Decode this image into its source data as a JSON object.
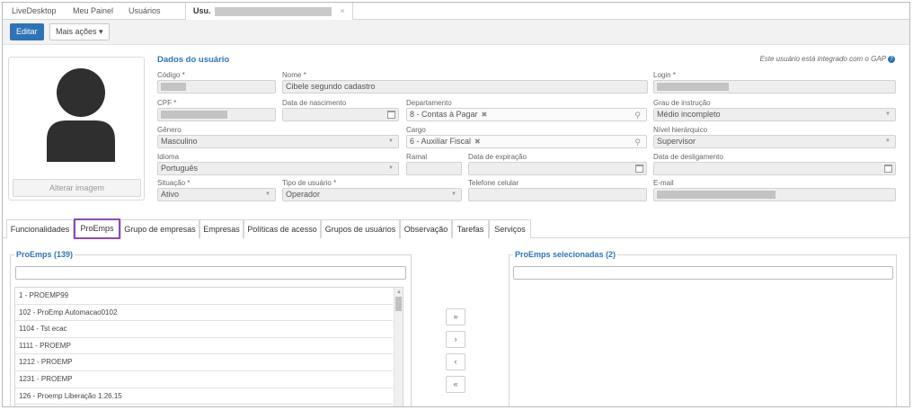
{
  "top_tabs": [
    {
      "label": "LiveDesktop"
    },
    {
      "label": "Meu Painel"
    },
    {
      "label": "Usuários"
    },
    {
      "label": "Usu.",
      "close": "×"
    }
  ],
  "toolbar": {
    "edit_label": "Editar",
    "more_actions_label": "Mais ações ▾"
  },
  "avatar": {
    "change_image_label": "Alterar imagem"
  },
  "form": {
    "section_title": "Dados do usuário",
    "gap_note": "Este usuário está integrado com o GAP",
    "gap_help": "?",
    "codigo_label": "Código *",
    "nome_label": "Nome *",
    "nome_value": "Cibele segundo cadastro",
    "login_label": "Login *",
    "cpf_label": "CPF *",
    "nascimento_label": "Data de nascimento",
    "departamento_label": "Departamento",
    "departamento_value": "8 - Contas à Pagar",
    "grau_label": "Grau de instrução",
    "grau_value": "Médio incompleto",
    "genero_label": "Gênero",
    "genero_value": "Masculino",
    "cargo_label": "Cargo",
    "cargo_value": "6 - Auxiliar Fiscal",
    "nivel_label": "Nível hierárquico",
    "nivel_value": "Supervisor",
    "idioma_label": "Idioma",
    "idioma_value": "Português",
    "ramal_label": "Ramal",
    "expiracao_label": "Data de expiração",
    "desligamento_label": "Data de desligamento",
    "situacao_label": "Situação *",
    "situacao_value": "Ativo",
    "tipo_label": "Tipo de usuário *",
    "tipo_value": "Operador",
    "telefone_label": "Telefone celular",
    "email_label": "E-mail"
  },
  "content_tabs": [
    {
      "label": "Funcionalidades"
    },
    {
      "label": "ProEmps"
    },
    {
      "label": "Grupo de empresas"
    },
    {
      "label": "Empresas"
    },
    {
      "label": "Políticas de acesso"
    },
    {
      "label": "Grupos de usuários"
    },
    {
      "label": "Observação"
    },
    {
      "label": "Tarefas"
    },
    {
      "label": "Serviços"
    }
  ],
  "available": {
    "title": "ProEmps (139)",
    "items": [
      "1 - PROEMP99",
      "102 - ProEmp Automacao0102",
      "1104 - Tst ecac",
      "1111 - PROEMP",
      "1212 - PROEMP",
      "1231 - PROEMP",
      "126 - Proemp Liberação 1.26.15"
    ]
  },
  "selected": {
    "title": "ProEmps selecionadas (2)"
  },
  "move_buttons": {
    "add_all": "»",
    "add": "›",
    "remove": "‹",
    "remove_all": "«"
  }
}
